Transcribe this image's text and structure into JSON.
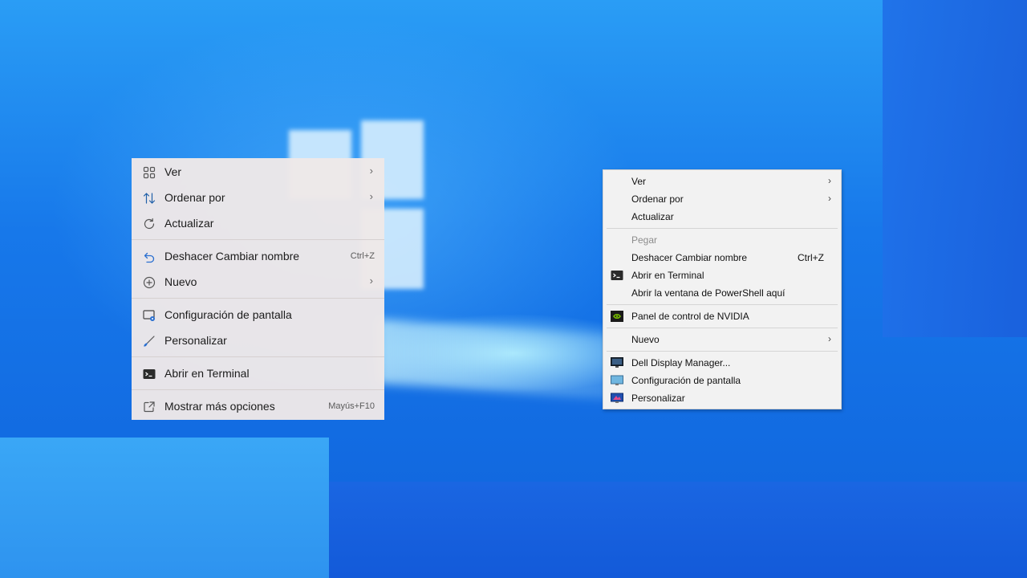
{
  "modern_menu": {
    "items": [
      {
        "label": "Ver",
        "icon": "grid-icon",
        "has_submenu": true
      },
      {
        "label": "Ordenar por",
        "icon": "sort-icon",
        "has_submenu": true
      },
      {
        "label": "Actualizar",
        "icon": "refresh-icon"
      },
      {
        "label": "Deshacer Cambiar nombre",
        "icon": "undo-icon",
        "shortcut": "Ctrl+Z"
      },
      {
        "label": "Nuevo",
        "icon": "plus-circle-icon",
        "has_submenu": true
      },
      {
        "label": "Configuración de pantalla",
        "icon": "display-settings-icon"
      },
      {
        "label": "Personalizar",
        "icon": "brush-icon"
      },
      {
        "label": "Abrir en Terminal",
        "icon": "terminal-icon"
      },
      {
        "label": "Mostrar más opciones",
        "icon": "more-options-icon",
        "shortcut": "Mayús+F10"
      }
    ],
    "submenu_glyph": "›"
  },
  "classic_menu": {
    "items": [
      {
        "label": "Ver",
        "has_submenu": true
      },
      {
        "label": "Ordenar por",
        "has_submenu": true
      },
      {
        "label": "Actualizar"
      },
      {
        "label": "Pegar",
        "disabled": true
      },
      {
        "label": "Deshacer Cambiar nombre",
        "shortcut": "Ctrl+Z"
      },
      {
        "label": "Abrir en Terminal",
        "icon": "terminal-icon"
      },
      {
        "label": "Abrir la ventana de PowerShell aquí"
      },
      {
        "label": "Panel de control de NVIDIA",
        "icon": "nvidia-icon"
      },
      {
        "label": "Nuevo",
        "has_submenu": true
      },
      {
        "label": "Dell Display Manager...",
        "icon": "monitor-icon"
      },
      {
        "label": "Configuración de pantalla",
        "icon": "display-settings-icon"
      },
      {
        "label": "Personalizar",
        "icon": "personalize-icon"
      }
    ],
    "submenu_glyph": "›"
  },
  "colors": {
    "accent": "#0067c0",
    "desktop_blue": "#1778ea",
    "nvidia_green": "#76b900"
  }
}
